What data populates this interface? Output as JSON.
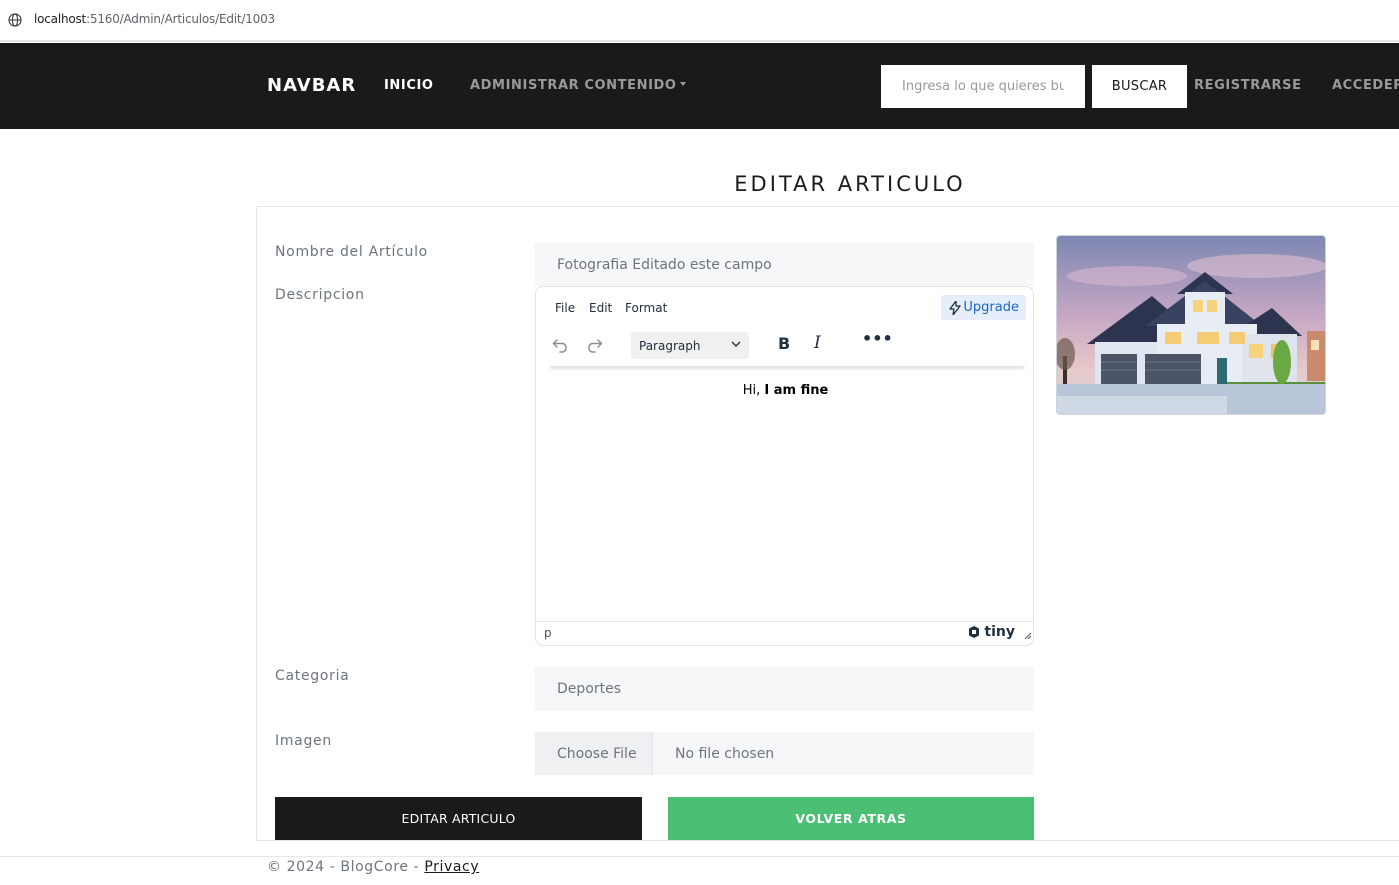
{
  "browser": {
    "url_host": "localhost",
    "url_rest": ":5160/Admin/Articulos/Edit/1003"
  },
  "navbar": {
    "brand": "NAVBAR",
    "links": {
      "inicio": "INICIO",
      "administrar": "ADMINISTRAR CONTENIDO",
      "registrarse": "REGISTRARSE",
      "acceder": "ACCEDER"
    },
    "search": {
      "placeholder": "Ingresa lo que quieres buscar",
      "button": "BUSCAR"
    }
  },
  "page": {
    "title": "EDITAR ARTICULO"
  },
  "form": {
    "nombre_label": "Nombre del Artículo",
    "nombre_value": "Fotografia Editado este campo",
    "descripcion_label": "Descripcion",
    "categoria_label": "Categoria",
    "categoria_value": "Deportes",
    "imagen_label": "Imagen",
    "file_button": "Choose File",
    "file_status": "No file chosen"
  },
  "editor": {
    "menu": [
      "File",
      "Edit",
      "Format"
    ],
    "upgrade": "Upgrade",
    "block_format": "Paragraph",
    "bold": "B",
    "italic": "I",
    "more": "•••",
    "content_plain": "Hi, ",
    "content_bold": "I am fine",
    "status_path": "p",
    "brand": "tiny"
  },
  "buttons": {
    "editar": "EDITAR ARTICULO",
    "volver": "VOLVER ATRAS"
  },
  "footer": {
    "text": "© 2024 - BlogCore - ",
    "link": "Privacy"
  }
}
